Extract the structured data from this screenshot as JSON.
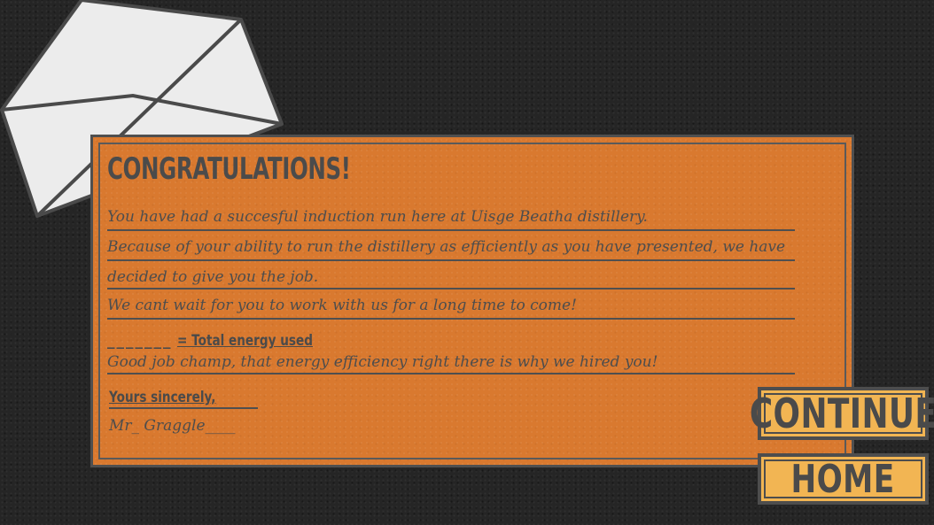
{
  "letter": {
    "title": "CONGRATULATIONS!",
    "lines": [
      "You have had a succesful induction run here at Uisge Beatha distillery.",
      "Because of your ability to run the distillery as efficiently as you have presented, we have",
      "decided to give you the job.",
      "We cant wait for you to work with us for a long time to come!"
    ],
    "energy_blank": "_______",
    "energy_label": "= Total energy used",
    "closing_line": "Good job champ, that energy efficiency right there is why we hired you!",
    "sign_off": "Yours sincerely,",
    "signature": "Mr_ Graggle____"
  },
  "buttons": {
    "continue": "CONTINUE",
    "home": "HOME"
  },
  "colors": {
    "card": "#d9792f",
    "button": "#f2b553",
    "ink": "#4a4a4a",
    "background": "#252525",
    "envelope": "#eeeeee"
  }
}
